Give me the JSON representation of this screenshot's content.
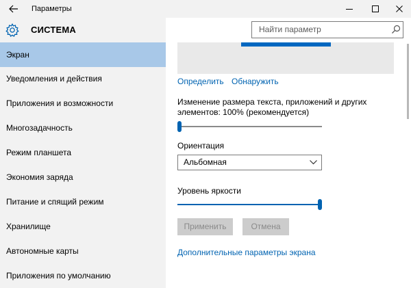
{
  "window": {
    "title": "Параметры",
    "back_icon": "back-arrow-icon",
    "minimize_icon": "minimize-icon",
    "maximize_icon": "maximize-icon",
    "close_icon": "close-icon"
  },
  "header": {
    "icon": "gear-icon",
    "title": "СИСТЕМА"
  },
  "search": {
    "placeholder": "Найти параметр",
    "icon": "search-icon"
  },
  "sidebar": {
    "items": [
      {
        "label": "Экран",
        "active": true
      },
      {
        "label": "Уведомления и действия",
        "active": false
      },
      {
        "label": "Приложения и возможности",
        "active": false
      },
      {
        "label": "Многозадачность",
        "active": false
      },
      {
        "label": "Режим планшета",
        "active": false
      },
      {
        "label": "Экономия заряда",
        "active": false
      },
      {
        "label": "Питание и спящий режим",
        "active": false
      },
      {
        "label": "Хранилище",
        "active": false
      },
      {
        "label": "Автономные карты",
        "active": false
      },
      {
        "label": "Приложения по умолчанию",
        "active": false
      }
    ]
  },
  "display": {
    "identify_link": "Определить",
    "detect_link": "Обнаружить",
    "scale_label_line1": "Изменение размера текста, приложений и других",
    "scale_label_line2": "элементов: 100% (рекомендуется)",
    "scale_value_fraction": 0.0,
    "orientation_label": "Ориентация",
    "orientation_value": "Альбомная",
    "brightness_label": "Уровень яркости",
    "brightness_value_fraction": 1.0,
    "apply_button": "Применить",
    "cancel_button": "Отмена",
    "advanced_link": "Дополнительные параметры экрана"
  },
  "colors": {
    "accent": "#0063b1",
    "sidebar_bg": "#f2f2f2",
    "active_item_bg": "#a8c8e8",
    "disabled_button_bg": "#cccccc"
  }
}
